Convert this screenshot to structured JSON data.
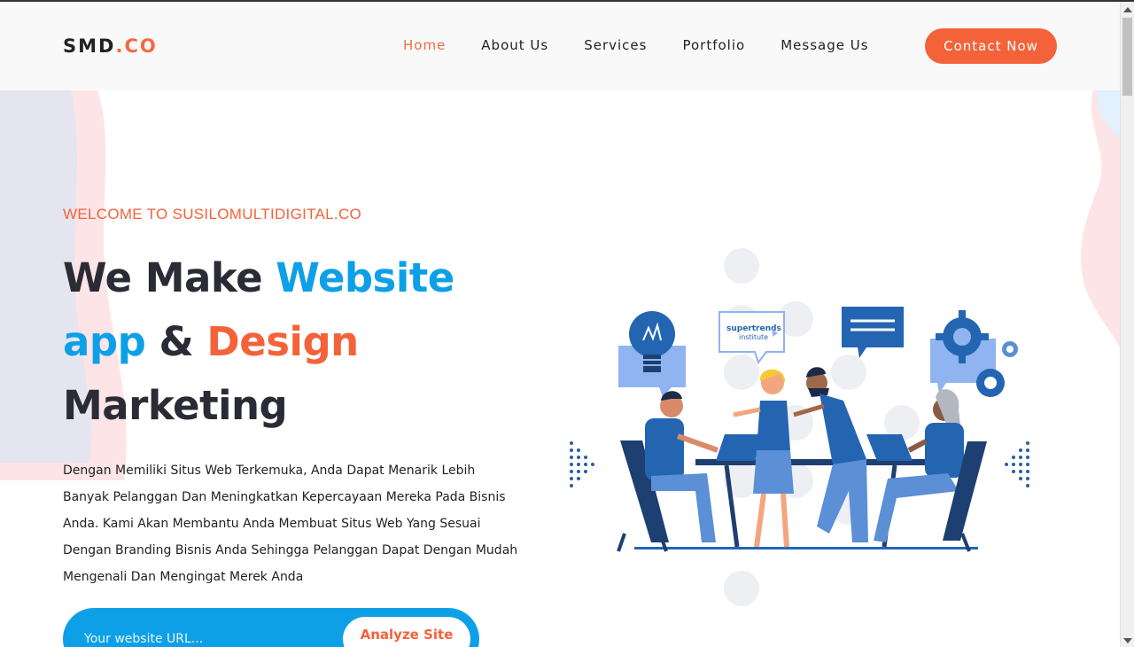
{
  "header": {
    "logo_main": "SMD",
    "logo_accent": ".CO",
    "nav": [
      {
        "label": "Home",
        "active": true
      },
      {
        "label": "About Us",
        "active": false
      },
      {
        "label": "Services",
        "active": false
      },
      {
        "label": "Portfolio",
        "active": false
      },
      {
        "label": "Message Us",
        "active": false
      }
    ],
    "cta_label": "Contact Now"
  },
  "hero": {
    "welcome": "WELCOME TO SUSILOMULTIDIGITAL.CO",
    "headline": {
      "part1": "We Make ",
      "part2_blue": "Website",
      "part3_blue": "app",
      "part4": " & ",
      "part5_orange": "Design",
      "part6": "Marketing"
    },
    "description": "Dengan Memiliki Situs Web Terkemuka, Anda Dapat Menarik Lebih Banyak Pelanggan Dan Meningkatkan Kepercayaan Mereka Pada Bisnis Anda. Kami Akan Membantu Anda Membuat Situs Web Yang Sesuai Dengan Branding Bisnis Anda Sehingga Pelanggan Dapat Dengan Mudah Mengenali Dan Mengingat Merek Anda",
    "url_placeholder": "Your website URL...",
    "analyze_label": "Analyze Site"
  },
  "illustration": {
    "badge_line1": "supertrends",
    "badge_line2": "institute"
  },
  "colors": {
    "accent_orange": "#f4623a",
    "accent_blue": "#0ea0e7",
    "text_dark": "#2b2b36"
  }
}
